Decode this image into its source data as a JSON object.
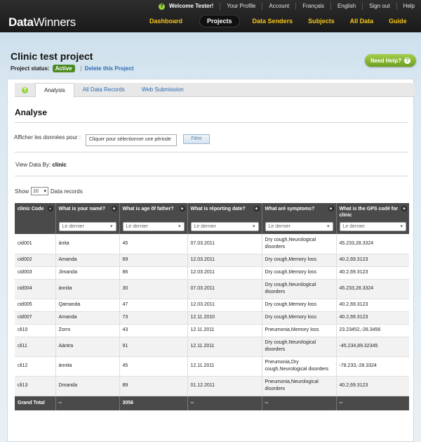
{
  "header": {
    "utility": [
      "Welcome Tester!",
      "Your Profile",
      "Account",
      "Français",
      "English",
      "Sign out",
      "Help"
    ],
    "logo_bold": "Data",
    "logo_rest": "Winners",
    "nav": [
      "Dashboard",
      "Projects",
      "Data Senders",
      "Subjects",
      "All Data",
      "Guide"
    ],
    "nav_active": "Projects"
  },
  "project": {
    "title": "Clinic test project",
    "status_label": "Project status:",
    "status": "Active",
    "delete_link": "Delete this Project",
    "need_help": "Need Help?"
  },
  "tabs": [
    {
      "label": "Analysis",
      "active": true
    },
    {
      "label": "All Data Records",
      "active": false
    },
    {
      "label": "Web Submission",
      "active": false
    }
  ],
  "analyse": {
    "heading": "Analyse",
    "filter_label": "Afficher les données pour :",
    "period_placeholder": "Cliquer pour sélectionner une période",
    "filter_button": "Filtre",
    "view_by_label": "View Data By:",
    "view_by_value": "clinic",
    "show_label": "Show",
    "show_value": "10",
    "records_label": "Data records"
  },
  "table": {
    "columns": [
      "clinic Code",
      "What is your namé?",
      "What is age õf father?",
      "What is réporting date?",
      "What aré symptoms?",
      "What is the GPS codé for clinic"
    ],
    "filter_placeholder": "Le dernier",
    "rows": [
      [
        "cid001",
        "ànita",
        "45",
        "07.03.2011",
        "Dry cough,Neurological disorders",
        "45.233,28.3324"
      ],
      [
        "cid002",
        "Amanda",
        "69",
        "12.03.2011",
        "Dry cough,Memory loss",
        "40.2,69.3123"
      ],
      [
        "cid003",
        "Jimanda",
        "86",
        "12.03.2011",
        "Dry cough,Memory loss",
        "40.2,69.3123"
      ],
      [
        "cid004",
        "ànnita",
        "30",
        "07.03.2011",
        "Dry cough,Neurological disorders",
        "45.233,28.3324"
      ],
      [
        "cid005",
        "Qamanda",
        "47",
        "12.03.2011",
        "Dry cough,Memory loss",
        "40.2,69.3123"
      ],
      [
        "cid007",
        "Amanda",
        "73",
        "12.11.2010",
        "Dry cough,Memory loss",
        "40.2,69.3123"
      ],
      [
        "cli10",
        "Zorro",
        "43",
        "12.11.2011",
        "Pneumonia,Memory loss",
        "23.23452,-28.3456"
      ],
      [
        "cli11",
        "Aàntra",
        "91",
        "12.11.2011",
        "Dry cough,Neurological disorders",
        "-45.234,89.32345"
      ],
      [
        "cli12",
        "ànnita",
        "45",
        "12.11.2011",
        "Pneumonia,Dry cough,Neurological disorders",
        "-78.233,-28.3324"
      ],
      [
        "cli13",
        "Dmanda",
        "89",
        "01.12.2011",
        "Pneumonia,Neurological disorders",
        "40.2,69.3123"
      ]
    ],
    "total": [
      "Grand Total",
      "--",
      "3056",
      "--",
      "--",
      "--"
    ]
  },
  "colors": {
    "accent_yellow": "#f5c518",
    "status_green": "#4a8a1f",
    "help_green": "#8dbb35",
    "link_blue": "#2a6ab0",
    "table_header": "#4a4a4a"
  }
}
